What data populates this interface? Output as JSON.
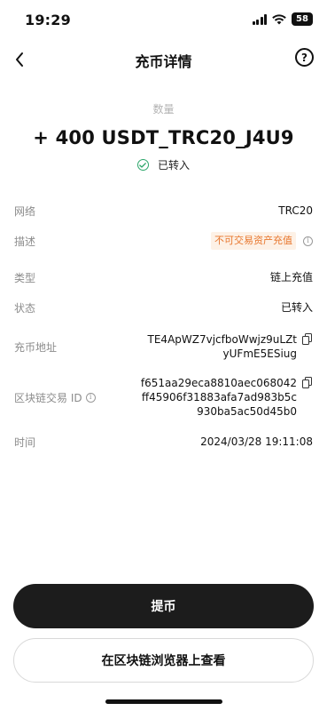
{
  "status_bar": {
    "time": "19:29",
    "battery": "58",
    "icons": [
      "signal-icon",
      "wifi-icon",
      "battery-icon"
    ]
  },
  "header": {
    "title": "充币详情",
    "back_icon": "chevron-left-icon",
    "help_label": "?"
  },
  "summary": {
    "amount_label": "数量",
    "amount": "+ 400 USDT_TRC20_J4U9",
    "status": "已转入",
    "status_color": "#2ca66a"
  },
  "details": {
    "network": {
      "label": "网络",
      "value": "TRC20"
    },
    "description": {
      "label": "描述",
      "value": "不可交易资产充值",
      "tag_color": "#e8772e"
    },
    "type": {
      "label": "类型",
      "value": "链上充值"
    },
    "state": {
      "label": "状态",
      "value": "已转入"
    },
    "address": {
      "label": "充币地址",
      "line1": "TE4ApWZ7vjcfboWwjz9uLZt",
      "line2": "yUFmE5ESiug"
    },
    "txid": {
      "label": "区块链交易 ID",
      "line1": "f651aa29eca8810aec068042",
      "line2": "ff45906f31883afa7ad983b5c",
      "line3": "930ba5ac50d45b0"
    },
    "time": {
      "label": "时间",
      "value": "2024/03/28 19:11:08"
    }
  },
  "actions": {
    "withdraw": "提币",
    "view_explorer": "在区块链浏览器上查看"
  }
}
